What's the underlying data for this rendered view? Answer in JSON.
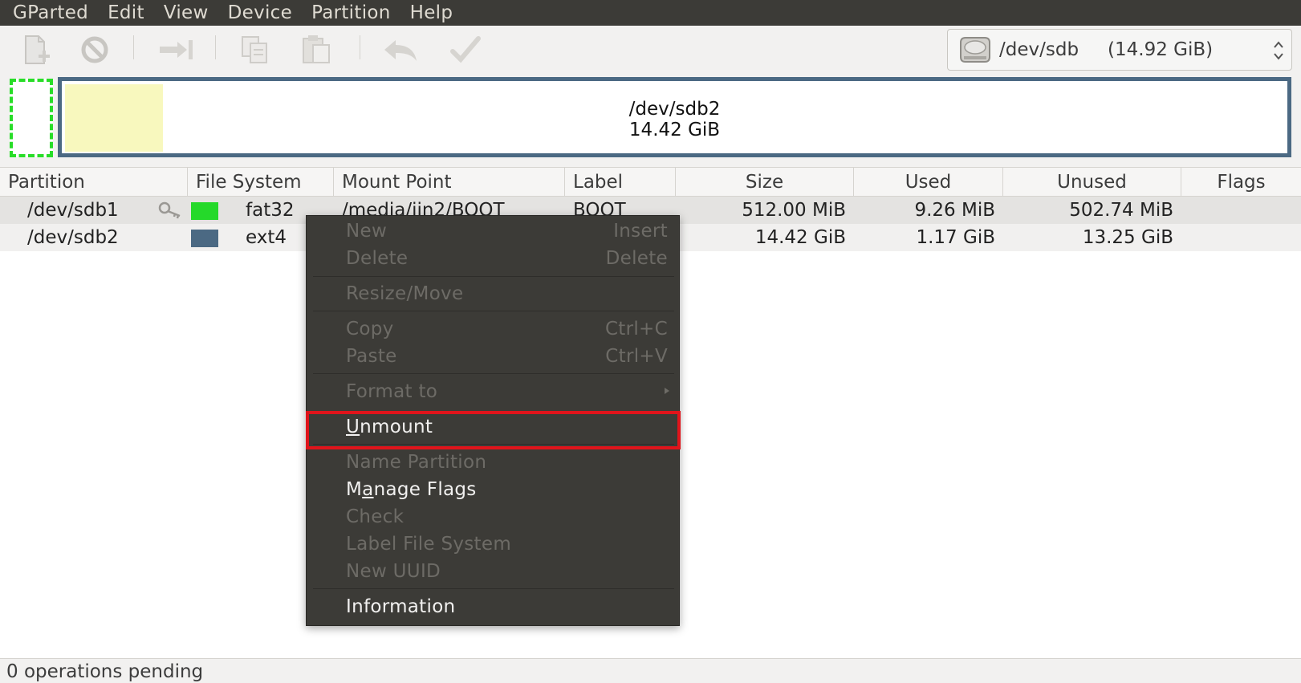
{
  "menubar": {
    "items": [
      "GParted",
      "Edit",
      "View",
      "Device",
      "Partition",
      "Help"
    ]
  },
  "toolbar": {
    "buttons": [
      {
        "name": "new",
        "icon": "new-partition-icon"
      },
      {
        "name": "delete",
        "icon": "delete-icon"
      },
      {
        "name": "resize-move",
        "icon": "resize-move-icon"
      },
      {
        "name": "copy",
        "icon": "copy-icon"
      },
      {
        "name": "paste",
        "icon": "paste-icon"
      },
      {
        "name": "undo",
        "icon": "undo-icon"
      },
      {
        "name": "apply",
        "icon": "apply-icon"
      }
    ],
    "device_selector": {
      "device": "/dev/sdb",
      "size": "(14.92 GiB)",
      "icon": "harddisk-icon"
    }
  },
  "partition_graphic": {
    "selected_name": "/dev/sdb2",
    "selected_size": "14.42 GiB"
  },
  "table": {
    "columns": [
      "Partition",
      "File System",
      "Mount Point",
      "Label",
      "Size",
      "Used",
      "Unused",
      "Flags"
    ],
    "rows": [
      {
        "partition": "/dev/sdb1",
        "filesystem": "fat32",
        "fs_color": "#25d92a",
        "mount_point": "/media/jin2/BOOT",
        "label": "BOOT",
        "size": "512.00 MiB",
        "used": "9.26 MiB",
        "unused": "502.74 MiB",
        "flags": "",
        "mounted_icon": "key-icon"
      },
      {
        "partition": "/dev/sdb2",
        "filesystem": "ext4",
        "fs_color": "#4b6983",
        "mount_point": "",
        "label": "",
        "size": "14.42 GiB",
        "used": "1.17 GiB",
        "unused": "13.25 GiB",
        "flags": ""
      }
    ]
  },
  "context_menu": {
    "items": [
      {
        "label": "New",
        "accel": "Insert",
        "enabled": false
      },
      {
        "label": "Delete",
        "accel": "Delete",
        "enabled": false
      },
      {
        "label": "Resize/Move",
        "accel": "",
        "enabled": false
      },
      {
        "label": "Copy",
        "accel": "Ctrl+C",
        "enabled": false
      },
      {
        "label": "Paste",
        "accel": "Ctrl+V",
        "enabled": false
      },
      {
        "label": "Format to",
        "accel": "",
        "enabled": false,
        "submenu": true
      },
      {
        "label": "Unmount",
        "accel": "",
        "enabled": true,
        "highlighted": true,
        "mnemonic": "U",
        "rest": "nmount"
      },
      {
        "label": "Name Partition",
        "accel": "",
        "enabled": false
      },
      {
        "label": "Manage Flags",
        "accel": "",
        "enabled": true,
        "pre": "M",
        "mnemonic": "a",
        "rest": "nage Flags"
      },
      {
        "label": "Check",
        "accel": "",
        "enabled": false
      },
      {
        "label": "Label File System",
        "accel": "",
        "enabled": false
      },
      {
        "label": "New UUID",
        "accel": "",
        "enabled": false
      },
      {
        "label": "Information",
        "accel": "",
        "enabled": true
      }
    ]
  },
  "statusbar": {
    "text": "0 operations pending"
  },
  "colors": {
    "highlight_box": "#e0141b",
    "unallocated_border": "#28dd28",
    "ext4": "#4b6983",
    "fat32": "#25d92a"
  }
}
